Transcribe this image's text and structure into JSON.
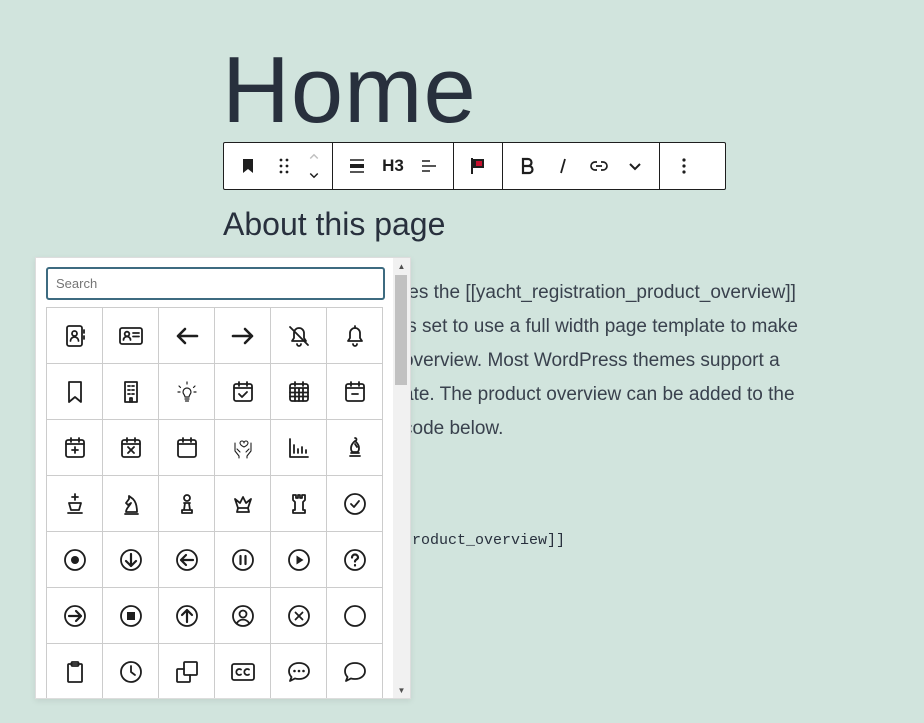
{
  "page": {
    "title": "Home",
    "heading": "About this page",
    "paragraph_lines": [
      "tes the [[yacht_registration_product_overview]]",
      "is set to use a full width page template to make",
      " overview. Most WordPress themes support a",
      "ate. The product overview can be added to the",
      "code below."
    ],
    "code_snippet": "product_overview]]"
  },
  "toolbar": {
    "heading_level": "H3"
  },
  "icon_picker": {
    "search_placeholder": "Search",
    "icons": [
      "contact-book-icon",
      "id-card-icon",
      "arrow-left-icon",
      "arrow-right-icon",
      "bell-off-icon",
      "bell-icon",
      "bookmark-icon",
      "building-icon",
      "bulb-icon",
      "calendar-check-icon",
      "calendar-grid-icon",
      "calendar-minus-icon",
      "calendar-plus-icon",
      "calendar-x-icon",
      "calendar-icon",
      "care-hands-icon",
      "bar-chart-icon",
      "chess-bishop-icon",
      "chess-king-icon",
      "chess-knight-icon",
      "chess-pawn-icon",
      "chess-queen-icon",
      "chess-rook-icon",
      "circle-check-icon",
      "circle-dot-icon",
      "circle-arrow-down-icon",
      "circle-arrow-left-icon",
      "circle-pause-icon",
      "circle-play-icon",
      "circle-help-icon",
      "circle-arrow-right-icon",
      "circle-stop-icon",
      "circle-arrow-up-icon",
      "circle-user-icon",
      "circle-x-icon",
      "circle-icon",
      "clipboard-icon",
      "clock-icon",
      "copy-icon",
      "closed-captions-icon",
      "message-dots-icon",
      "message-icon"
    ]
  }
}
